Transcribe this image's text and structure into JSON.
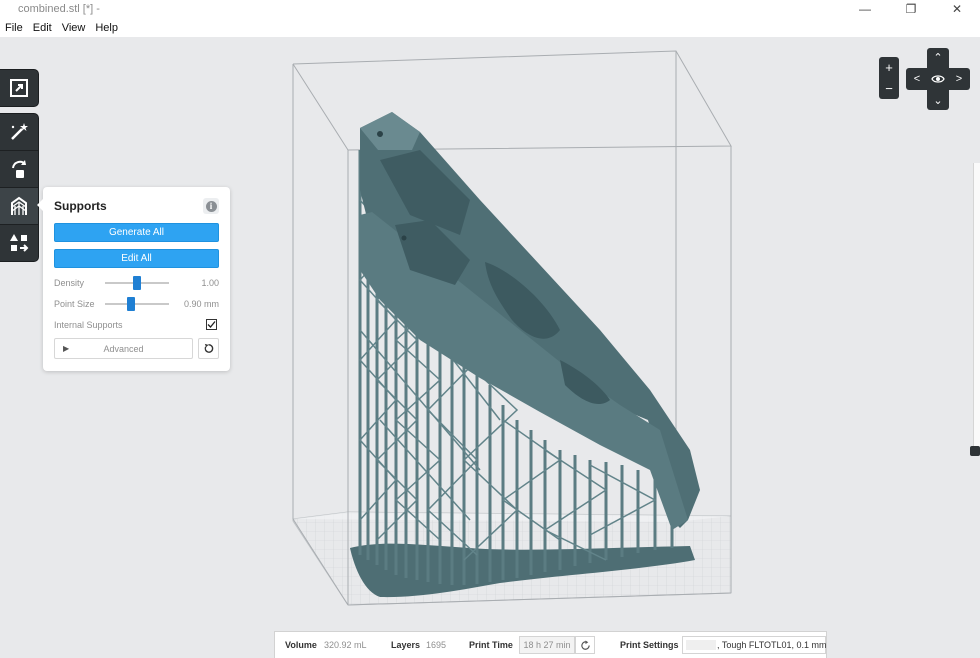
{
  "window": {
    "title": "combined.stl [*] -",
    "controls": {
      "minimize": "—",
      "restore": "❐",
      "close": "✕"
    }
  },
  "menu": {
    "items": [
      {
        "label": "File"
      },
      {
        "label": "Edit"
      },
      {
        "label": "View"
      },
      {
        "label": "Help"
      }
    ]
  },
  "toolbar": {
    "tools": [
      {
        "name": "scale-tool",
        "icon": "expand-icon"
      },
      {
        "name": "magic-wand-tool",
        "icon": "magic-wand-icon"
      },
      {
        "name": "orientation-tool",
        "icon": "rotate-icon"
      },
      {
        "name": "supports-tool",
        "icon": "supports-icon",
        "active": true
      },
      {
        "name": "layout-tool",
        "icon": "layout-icon"
      }
    ]
  },
  "supports_panel": {
    "title": "Supports",
    "info_icon": "i",
    "generate_all_label": "Generate All",
    "edit_all_label": "Edit All",
    "density": {
      "label": "Density",
      "value": "1.00",
      "level": 0.5
    },
    "point_size": {
      "label": "Point Size",
      "value": "0.90 mm",
      "level": 0.4
    },
    "internal_supports": {
      "label": "Internal Supports",
      "checked": true
    },
    "advanced_label": "Advanced"
  },
  "navigation": {
    "zoom_in": "+",
    "zoom_out": "−",
    "up": "⌃",
    "down": "⌄",
    "left": "<",
    "right": ">"
  },
  "status": {
    "volume_label": "Volume",
    "volume_value": "320.92 mL",
    "layers_label": "Layers",
    "layers_value": "1695",
    "print_time_label": "Print Time",
    "print_time_value": "18 h 27 min",
    "print_settings_label": "Print Settings",
    "print_settings_value": ", Tough FLTOTL01, 0.1 mm"
  },
  "colors": {
    "model": "#4e6e74",
    "toolbar_bg": "#2f3437",
    "accent_blue": "#2ea3f2",
    "slider_blue": "#1f7fd3",
    "viewport_bg": "#e8e9eb"
  }
}
